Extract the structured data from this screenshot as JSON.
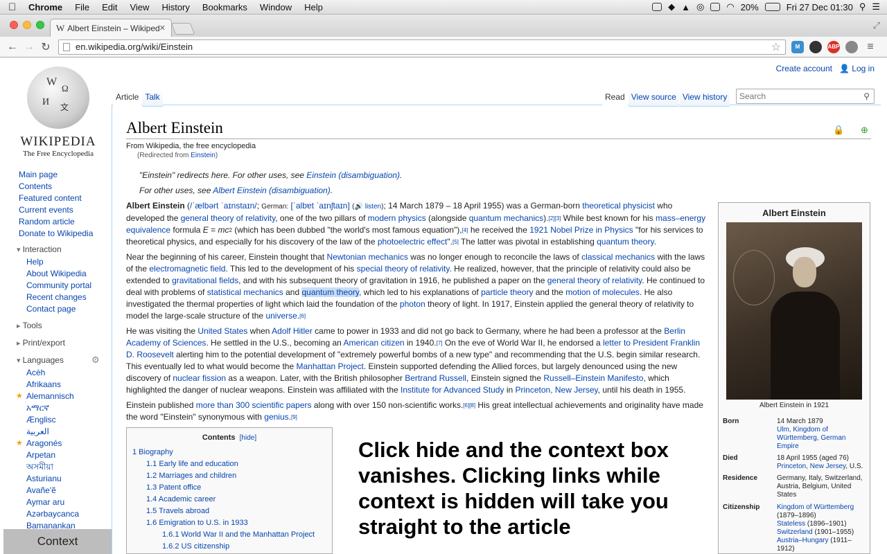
{
  "menubar": {
    "app": "Chrome",
    "items": [
      "File",
      "Edit",
      "View",
      "History",
      "Bookmarks",
      "Window",
      "Help"
    ],
    "battery": "20%",
    "clock": "Fri 27 Dec  01:30"
  },
  "tab": {
    "title": "Albert Einstein – Wikipedia",
    "favicon": "W",
    "close": "✕"
  },
  "url": "en.wikipedia.org/wiki/Einstein",
  "ext": {
    "m": "M",
    "abp": "ABP"
  },
  "sidebar": {
    "logo_title": "WIKIPEDIA",
    "logo_sub": "The Free Encyclopedia",
    "nav": [
      "Main page",
      "Contents",
      "Featured content",
      "Current events",
      "Random article",
      "Donate to Wikipedia"
    ],
    "interaction_h": "Interaction",
    "interaction": [
      "Help",
      "About Wikipedia",
      "Community portal",
      "Recent changes",
      "Contact page"
    ],
    "tools_h": "Tools",
    "print_h": "Print/export",
    "languages_h": "Languages",
    "languages": [
      "Acèh",
      "Afrikaans",
      "Alemannisch",
      "አማርኛ",
      "Ænglisc",
      "العربية",
      "Aragonés",
      "Arpetan",
      "অসমীয়া",
      "Asturianu",
      "Avañe'ẽ",
      "Aymar aru",
      "Azərbaycanca",
      "Bamanankan"
    ],
    "context": "Context"
  },
  "account": {
    "create": "Create account",
    "login": "Log in"
  },
  "tabs": {
    "article": "Article",
    "talk": "Talk",
    "read": "Read",
    "source": "View source",
    "history": "View history"
  },
  "search_ph": "Search",
  "article": {
    "title": "Albert Einstein",
    "from": "From Wikipedia, the free encyclopedia",
    "redirected": "(Redirected from ",
    "redirected_link": "Einstein",
    "redirected_end": ")",
    "hat1a": "\"Einstein\" redirects here. For other uses, see ",
    "hat1b": "Einstein (disambiguation)",
    "hat1c": ".",
    "hat2a": "For other uses, see ",
    "hat2b": "Albert Einstein (disambiguation)",
    "hat2c": "."
  },
  "infobox": {
    "title": "Albert Einstein",
    "caption": "Albert Einstein in 1921",
    "born_k": "Born",
    "born_v1": "14 March 1879",
    "born_v2": "Ulm, Kingdom of Württemberg, German Empire",
    "died_k": "Died",
    "died_v1": "18 April 1955 (aged 76)",
    "died_v2": "Princeton, New Jersey",
    "died_v3": ", U.S.",
    "res_k": "Residence",
    "res_v": "Germany, Italy, Switzerland, Austria, Belgium, United States",
    "cit_k": "Citizenship",
    "cit_1": "Kingdom of Württemberg",
    "cit_1d": "(1879–1896)",
    "cit_2": "Stateless",
    "cit_2d": " (1896–1901)",
    "cit_3": "Switzerland",
    "cit_3d": " (1901–1955)",
    "cit_4": "Austria–Hungary",
    "cit_4d": " (1911–1912)"
  },
  "toc": {
    "title": "Contents",
    "hide": "[hide]",
    "items": [
      "1 Biography",
      "1.1 Early life and education",
      "1.2 Marriages and children",
      "1.3 Patent office",
      "1.4 Academic career",
      "1.5 Travels abroad",
      "1.6 Emigration to U.S. in 1933",
      "1.6.1 World War II and the Manhattan Project",
      "1.6.2 US citizenship"
    ]
  },
  "overlay": "Click hide and the context box vanishes. Clicking links while context is hidden will take you straight to the article"
}
